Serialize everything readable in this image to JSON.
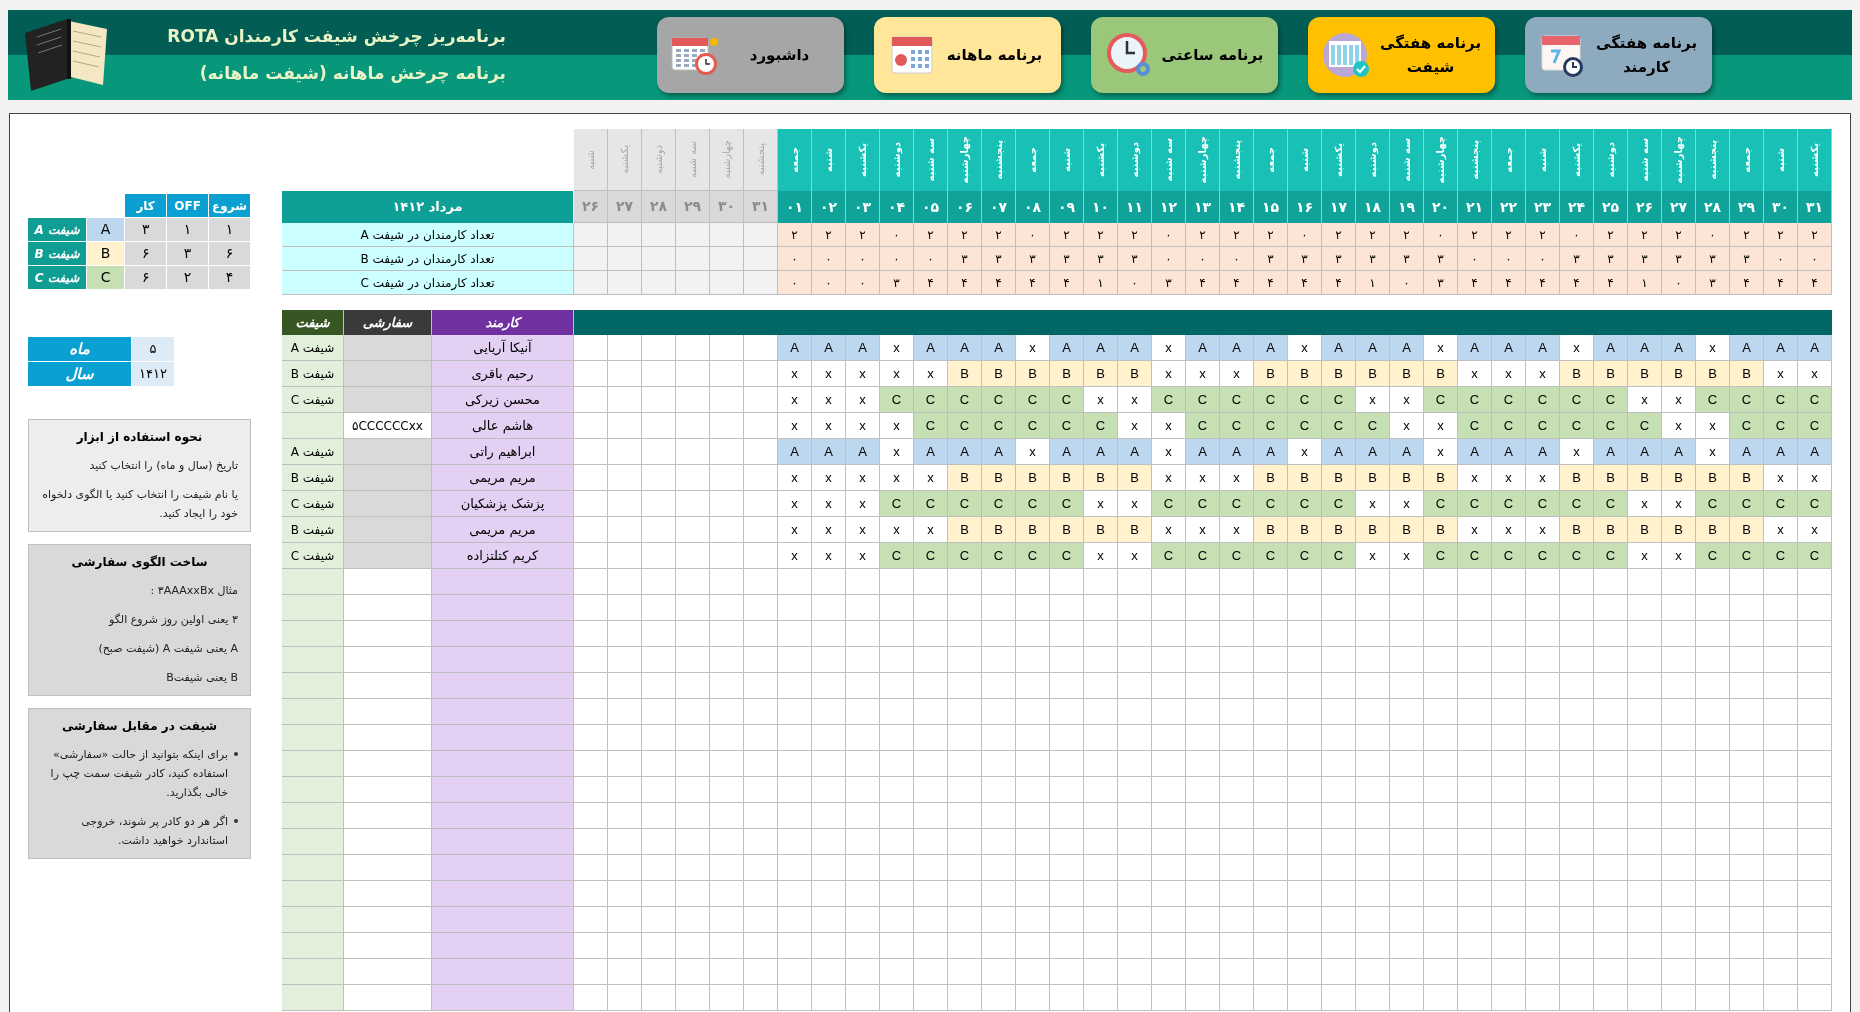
{
  "header": {
    "title": "برنامه‌ریز چرخش شیفت کارمندان ROTA",
    "subtitle": "برنامه چرخش ماهانه (شیفت ماهانه)"
  },
  "nav_buttons": [
    {
      "label": "برنامه هفتگی کارمند",
      "kind": "weekly",
      "color": "#8eaabe"
    },
    {
      "label": "برنامه هفتگی شیفت",
      "kind": "table",
      "color": "#ffc000"
    },
    {
      "label": "برنامه ساعتی",
      "kind": "clock",
      "color": "#9bc77a"
    },
    {
      "label": "برنامه ماهانه",
      "kind": "calendar",
      "color": "#ffe699"
    },
    {
      "label": "داشبورد",
      "kind": "dashboard",
      "color": "#a6a6a6"
    }
  ],
  "shift_table": {
    "columns": [
      "شروع",
      "OFF",
      "کار"
    ],
    "rows": [
      {
        "values": [
          "۱",
          "۱",
          "۳"
        ],
        "letter": "A",
        "color": "#bdd7ee",
        "label": "شیفت A"
      },
      {
        "values": [
          "۶",
          "۳",
          "۶"
        ],
        "letter": "B",
        "color": "#fff2cc",
        "label": "شیفت B"
      },
      {
        "values": [
          "۴",
          "۲",
          "۶"
        ],
        "letter": "C",
        "color": "#c6e0b4",
        "label": "شیفت C"
      }
    ]
  },
  "period": [
    {
      "value": "۵",
      "label": "ماه"
    },
    {
      "value": "۱۴۱۲",
      "label": "سال"
    }
  ],
  "help_boxes": [
    {
      "kind": "text",
      "title": "نحوه استفاده از ابزار",
      "lines": [
        "تاریخ (سال و ماه) را انتخاب کنید",
        "یا نام شیفت را انتخاب کنید  یا الگوی دلخواه خود را ایجاد کنید."
      ]
    },
    {
      "kind": "text",
      "title": "ساخت الگوی سفارشی",
      "lines": [
        "مثال ۳AAAxxBx :",
        "۳ یعنی  اولین روز شروع الگو",
        "A یعنی شیفت  A (شیفت صبح)",
        "B یعنی شیفتB"
      ]
    },
    {
      "kind": "bullets",
      "title": "شیفت در مقابل سفارشی",
      "lines": [
        "برای اینکه بتوانید از حالت «سفارشی» استفاده کنید، کادر شیفت سمت چپ را خالی بگذارید.",
        "اگر هر دو کادر پر شوند، خروجی استاندارد خواهید داشت."
      ]
    }
  ],
  "calendar": {
    "days": [
      {
        "name": "یکشنبه",
        "day": "۳۱"
      },
      {
        "name": "شنبه",
        "day": "۳۰"
      },
      {
        "name": "جمعه",
        "day": "۲۹"
      },
      {
        "name": "پنجشنبه",
        "day": "۲۸"
      },
      {
        "name": "چهارشنبه",
        "day": "۲۷"
      },
      {
        "name": "سه شنبه",
        "day": "۲۶"
      },
      {
        "name": "دوشنبه",
        "day": "۲۵"
      },
      {
        "name": "یکشنبه",
        "day": "۲۴"
      },
      {
        "name": "شنبه",
        "day": "۲۳"
      },
      {
        "name": "جمعه",
        "day": "۲۲"
      },
      {
        "name": "پنجشنبه",
        "day": "۲۱"
      },
      {
        "name": "چهارشنبه",
        "day": "۲۰"
      },
      {
        "name": "سه شنبه",
        "day": "۱۹"
      },
      {
        "name": "دوشنبه",
        "day": "۱۸"
      },
      {
        "name": "یکشنبه",
        "day": "۱۷"
      },
      {
        "name": "شنبه",
        "day": "۱۶"
      },
      {
        "name": "جمعه",
        "day": "۱۵"
      },
      {
        "name": "پنجشنبه",
        "day": "۱۴"
      },
      {
        "name": "چهارشنبه",
        "day": "۱۳"
      },
      {
        "name": "سه شنبه",
        "day": "۱۲"
      },
      {
        "name": "دوشنبه",
        "day": "۱۱"
      },
      {
        "name": "یکشنبه",
        "day": "۱۰"
      },
      {
        "name": "شنبه",
        "day": "۰۹"
      },
      {
        "name": "جمعه",
        "day": "۰۸"
      },
      {
        "name": "پنجشنبه",
        "day": "۰۷"
      },
      {
        "name": "چهارشنبه",
        "day": "۰۶"
      },
      {
        "name": "سه شنبه",
        "day": "۰۵"
      },
      {
        "name": "دوشنبه",
        "day": "۰۴"
      },
      {
        "name": "یکشنبه",
        "day": "۰۳"
      },
      {
        "name": "شنبه",
        "day": "۰۲"
      },
      {
        "name": "جمعه",
        "day": "۰۱"
      }
    ],
    "prev_days": [
      {
        "name": "پنجشنبه",
        "day": "۳۱"
      },
      {
        "name": "چهارشنبه",
        "day": "۳۰"
      },
      {
        "name": "سه شنبه",
        "day": "۲۹"
      },
      {
        "name": "دوشنبه",
        "day": "۲۸"
      },
      {
        "name": "یکشنبه",
        "day": "۲۷"
      },
      {
        "name": "شنبه",
        "day": "۲۶"
      }
    ],
    "month_title": "مرداد ۱۴۱۲",
    "summary": [
      {
        "values": [
          "۲",
          "۲",
          "۲",
          "۰",
          "۲",
          "۲",
          "۲",
          "۰",
          "۲",
          "۲",
          "۲",
          "۰",
          "۲",
          "۲",
          "۲",
          "۰",
          "۲",
          "۲",
          "۲",
          "۰",
          "۲",
          "۲",
          "۲",
          "۰",
          "۲",
          "۲",
          "۲",
          "۰",
          "۲",
          "۲",
          "۲"
        ],
        "label": "تعداد کارمندان در شیفت A"
      },
      {
        "values": [
          "۰",
          "۰",
          "۳",
          "۳",
          "۳",
          "۳",
          "۳",
          "۳",
          "۰",
          "۰",
          "۰",
          "۳",
          "۳",
          "۳",
          "۳",
          "۳",
          "۳",
          "۰",
          "۰",
          "۰",
          "۳",
          "۳",
          "۳",
          "۳",
          "۳",
          "۳",
          "۰",
          "۰",
          "۰",
          "۰",
          "۰"
        ],
        "label": "تعداد کارمندان در شیفت B"
      },
      {
        "values": [
          "۴",
          "۴",
          "۴",
          "۳",
          "۰",
          "۱",
          "۴",
          "۴",
          "۴",
          "۴",
          "۴",
          "۳",
          "۰",
          "۱",
          "۴",
          "۴",
          "۴",
          "۴",
          "۴",
          "۳",
          "۰",
          "۱",
          "۴",
          "۴",
          "۴",
          "۴",
          "۴",
          "۳",
          "۰",
          "۰",
          "۰"
        ],
        "label": "تعداد کارمندان در شیفت C"
      }
    ]
  },
  "roster": {
    "columns": [
      "کارمند",
      "سفارشی",
      "شیفت"
    ],
    "rows": [
      {
        "cells": [
          "A",
          "A",
          "A",
          "x",
          "A",
          "A",
          "A",
          "x",
          "A",
          "A",
          "A",
          "x",
          "A",
          "A",
          "A",
          "x",
          "A",
          "A",
          "A",
          "x",
          "A",
          "A",
          "A",
          "x",
          "A",
          "A",
          "A",
          "x",
          "A",
          "A",
          "A"
        ],
        "on": [
          true,
          true,
          true,
          false,
          true,
          true,
          true,
          false,
          true,
          true,
          true,
          false,
          true,
          true,
          true,
          false,
          true,
          true,
          true,
          false,
          true,
          true,
          true,
          false,
          true,
          true,
          true,
          false,
          true,
          true,
          true
        ],
        "color": "#bdd7ee",
        "name": "آنیکا آریایی",
        "shift": "شیفت A"
      },
      {
        "cells": [
          "x",
          "x",
          "B",
          "B",
          "B",
          "B",
          "B",
          "B",
          "x",
          "x",
          "x",
          "B",
          "B",
          "B",
          "B",
          "B",
          "B",
          "x",
          "x",
          "x",
          "B",
          "B",
          "B",
          "B",
          "B",
          "B",
          "x",
          "x",
          "x",
          "x",
          "x"
        ],
        "on": [
          false,
          false,
          true,
          true,
          true,
          true,
          true,
          true,
          false,
          false,
          false,
          true,
          true,
          true,
          true,
          true,
          true,
          false,
          false,
          false,
          true,
          true,
          true,
          true,
          true,
          true,
          false,
          false,
          false,
          false,
          false
        ],
        "color": "#fff2cc",
        "name": "رحیم باقری",
        "shift": "شیفت B"
      },
      {
        "cells": [
          "C",
          "C",
          "C",
          "C",
          "x",
          "x",
          "C",
          "C",
          "C",
          "C",
          "C",
          "C",
          "x",
          "x",
          "C",
          "C",
          "C",
          "C",
          "C",
          "C",
          "x",
          "x",
          "C",
          "C",
          "C",
          "C",
          "C",
          "C",
          "x",
          "x",
          "x"
        ],
        "on": [
          true,
          true,
          true,
          true,
          false,
          false,
          true,
          true,
          true,
          true,
          true,
          true,
          false,
          false,
          true,
          true,
          true,
          true,
          true,
          true,
          false,
          false,
          true,
          true,
          true,
          true,
          true,
          true,
          false,
          false,
          false
        ],
        "color": "#c6e0b4",
        "name": "محسن زیرکی",
        "shift": "شیفت C"
      },
      {
        "cells": [
          "C",
          "C",
          "C",
          "x",
          "x",
          "C",
          "C",
          "C",
          "C",
          "C",
          "C",
          "x",
          "x",
          "C",
          "C",
          "C",
          "C",
          "C",
          "C",
          "x",
          "x",
          "C",
          "C",
          "C",
          "C",
          "C",
          "C",
          "x",
          "x",
          "x",
          "x"
        ],
        "on": [
          true,
          true,
          true,
          false,
          false,
          true,
          true,
          true,
          true,
          true,
          true,
          false,
          false,
          true,
          true,
          true,
          true,
          true,
          true,
          false,
          false,
          true,
          true,
          true,
          true,
          true,
          true,
          false,
          false,
          false,
          false
        ],
        "color": "#c6e0b4",
        "name": "هاشم عالی",
        "custom": "۵CCCCCCxx"
      },
      {
        "cells": [
          "A",
          "A",
          "A",
          "x",
          "A",
          "A",
          "A",
          "x",
          "A",
          "A",
          "A",
          "x",
          "A",
          "A",
          "A",
          "x",
          "A",
          "A",
          "A",
          "x",
          "A",
          "A",
          "A",
          "x",
          "A",
          "A",
          "A",
          "x",
          "A",
          "A",
          "A"
        ],
        "on": [
          true,
          true,
          true,
          false,
          true,
          true,
          true,
          false,
          true,
          true,
          true,
          false,
          true,
          true,
          true,
          false,
          true,
          true,
          true,
          false,
          true,
          true,
          true,
          false,
          true,
          true,
          true,
          false,
          true,
          true,
          true
        ],
        "color": "#bdd7ee",
        "name": "ابراهیم راتی",
        "shift": "شیفت A"
      },
      {
        "cells": [
          "x",
          "x",
          "B",
          "B",
          "B",
          "B",
          "B",
          "B",
          "x",
          "x",
          "x",
          "B",
          "B",
          "B",
          "B",
          "B",
          "B",
          "x",
          "x",
          "x",
          "B",
          "B",
          "B",
          "B",
          "B",
          "B",
          "x",
          "x",
          "x",
          "x",
          "x"
        ],
        "on": [
          false,
          false,
          true,
          true,
          true,
          true,
          true,
          true,
          false,
          false,
          false,
          true,
          true,
          true,
          true,
          true,
          true,
          false,
          false,
          false,
          true,
          true,
          true,
          true,
          true,
          true,
          false,
          false,
          false,
          false,
          false
        ],
        "color": "#fff2cc",
        "name": "مریم مریمی",
        "shift": "شیفت B"
      },
      {
        "cells": [
          "C",
          "C",
          "C",
          "C",
          "x",
          "x",
          "C",
          "C",
          "C",
          "C",
          "C",
          "C",
          "x",
          "x",
          "C",
          "C",
          "C",
          "C",
          "C",
          "C",
          "x",
          "x",
          "C",
          "C",
          "C",
          "C",
          "C",
          "C",
          "x",
          "x",
          "x"
        ],
        "on": [
          true,
          true,
          true,
          true,
          false,
          false,
          true,
          true,
          true,
          true,
          true,
          true,
          false,
          false,
          true,
          true,
          true,
          true,
          true,
          true,
          false,
          false,
          true,
          true,
          true,
          true,
          true,
          true,
          false,
          false,
          false
        ],
        "color": "#c6e0b4",
        "name": "پزشک پزشکیان",
        "shift": "شیفت C"
      },
      {
        "cells": [
          "x",
          "x",
          "B",
          "B",
          "B",
          "B",
          "B",
          "B",
          "x",
          "x",
          "x",
          "B",
          "B",
          "B",
          "B",
          "B",
          "B",
          "x",
          "x",
          "x",
          "B",
          "B",
          "B",
          "B",
          "B",
          "B",
          "x",
          "x",
          "x",
          "x",
          "x"
        ],
        "on": [
          false,
          false,
          true,
          true,
          true,
          true,
          true,
          true,
          false,
          false,
          false,
          true,
          true,
          true,
          true,
          true,
          true,
          false,
          false,
          false,
          true,
          true,
          true,
          true,
          true,
          true,
          false,
          false,
          false,
          false,
          false
        ],
        "color": "#fff2cc",
        "name": "مریم مریمی",
        "shift": "شیفت B"
      },
      {
        "cells": [
          "C",
          "C",
          "C",
          "C",
          "x",
          "x",
          "C",
          "C",
          "C",
          "C",
          "C",
          "C",
          "x",
          "x",
          "C",
          "C",
          "C",
          "C",
          "C",
          "C",
          "x",
          "x",
          "C",
          "C",
          "C",
          "C",
          "C",
          "C",
          "x",
          "x",
          "x"
        ],
        "on": [
          true,
          true,
          true,
          true,
          false,
          false,
          true,
          true,
          true,
          true,
          true,
          true,
          false,
          false,
          true,
          true,
          true,
          true,
          true,
          true,
          false,
          false,
          true,
          true,
          true,
          true,
          true,
          true,
          false,
          false,
          false
        ],
        "color": "#c6e0b4",
        "name": "کریم کتلتزاده",
        "shift": "شیفت C"
      }
    ]
  }
}
